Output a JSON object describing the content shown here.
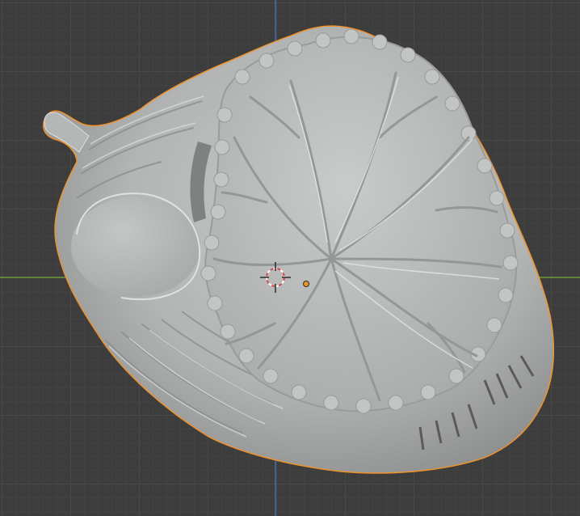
{
  "viewport": {
    "background_color": "#3d3d3d",
    "grid_minor_color": "#454545",
    "grid_major_color": "#4d4d4d",
    "axis_x_color": "#6e9a3b",
    "axis_y_color": "#3f6ea6",
    "selection_outline_color": "#f0922a",
    "mesh_color": "#b7b9b9",
    "origin_color": "#f0922a",
    "cursor_colors": [
      "#d84a4a",
      "#ffffff"
    ]
  },
  "scene": {
    "object_icon": "cerebellum-mesh",
    "object_selected": true,
    "cursor_icon": "3d-cursor-icon",
    "origin_icon": "object-origin-dot"
  }
}
